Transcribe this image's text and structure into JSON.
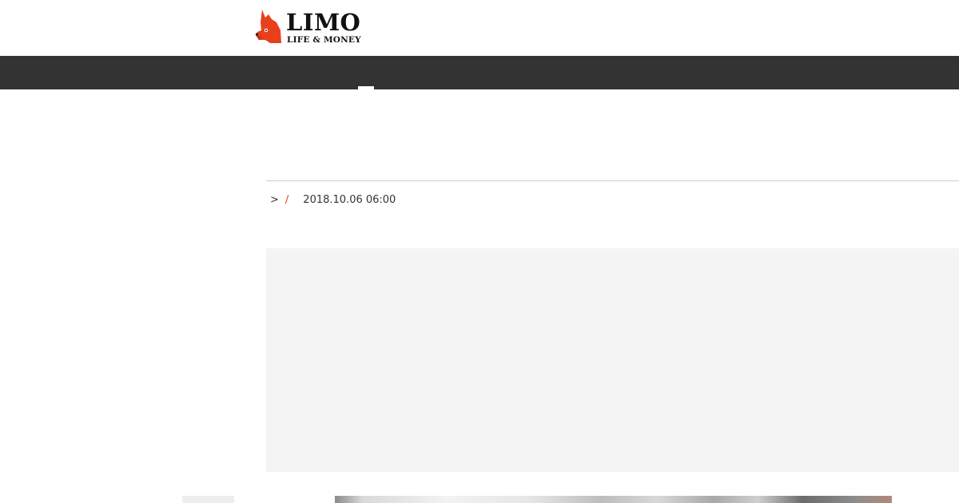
{
  "brand": {
    "name": "LIMO",
    "tagline": "LIFE & MONEY",
    "mark_color": "#e8401c"
  },
  "theme": {
    "nav_bg": "#333333",
    "accent": "#e8401c",
    "ad_bg": "#f4f4f4"
  },
  "breadcrumb": {
    "separator": ">",
    "slash": "/",
    "date": "2018.10.06 06:00"
  }
}
